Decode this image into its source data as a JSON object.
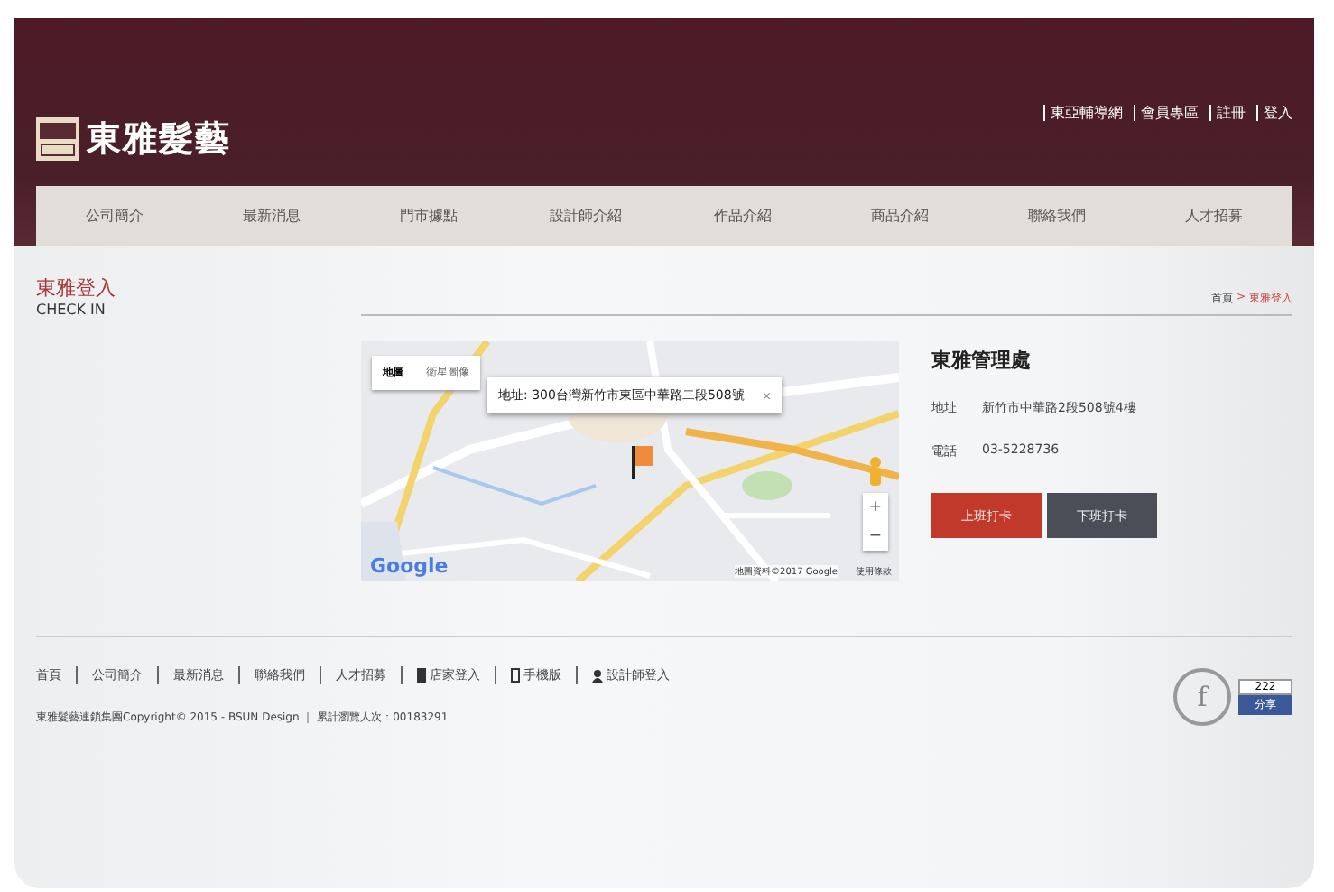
{
  "brand": {
    "name": "東雅髮藝"
  },
  "top_links": [
    "東亞輔導網",
    "會員專區",
    "註冊",
    "登入"
  ],
  "nav": [
    {
      "label": "公司簡介",
      "selected": false
    },
    {
      "label": "最新消息",
      "selected": false
    },
    {
      "label": "門市據點",
      "selected": false
    },
    {
      "label": "設計師介紹",
      "selected": false
    },
    {
      "label": "作品介紹",
      "selected": false
    },
    {
      "label": "商品介紹",
      "selected": false
    },
    {
      "label": "聯絡我們",
      "selected": false
    },
    {
      "label": "人才招募",
      "selected": false
    }
  ],
  "page": {
    "title": "東雅登入",
    "subtitle": "CHECK IN",
    "breadcrumb": [
      "首頁",
      "東雅登入"
    ],
    "breadcrumb_separator": ">"
  },
  "map": {
    "view_tabs": [
      {
        "label": "地圖",
        "selected": true
      },
      {
        "label": "衛星圖像",
        "selected": false
      }
    ],
    "info": "地址: 300台灣新竹市東區中華路二段508號",
    "close": "×",
    "zoom_in": "+",
    "zoom_out": "−",
    "logo": "Google",
    "attribution": "地圖資料©2017 Google",
    "terms": "使用條款"
  },
  "office": {
    "name": "東雅管理處",
    "fields": [
      {
        "label": "地址",
        "value": "新竹市中華路2段508號4樓"
      },
      {
        "label": "電話",
        "value": "03-5228736"
      }
    ],
    "buttons": [
      {
        "label": "上班打卡",
        "kind": "primary"
      },
      {
        "label": "下班打卡",
        "kind": "secondary"
      }
    ]
  },
  "footer": {
    "links": [
      {
        "label": "首頁",
        "kind": "plain"
      },
      {
        "label": "公司簡介",
        "kind": "plain"
      },
      {
        "label": "最新消息",
        "kind": "plain"
      },
      {
        "label": "聯絡我們",
        "kind": "plain"
      },
      {
        "label": "人才招募",
        "kind": "plain"
      },
      {
        "label": "店家登入",
        "kind": "store"
      },
      {
        "label": "手機版",
        "kind": "mobile"
      },
      {
        "label": "設計師登入",
        "kind": "designer"
      }
    ],
    "copyright": "東雅髮藝連鎖集團Copyright© 2015 - BSUN Design ｜ 累計瀏覽人次：00183291",
    "facebook": "f",
    "like_count": "222",
    "like_label": "分享"
  }
}
